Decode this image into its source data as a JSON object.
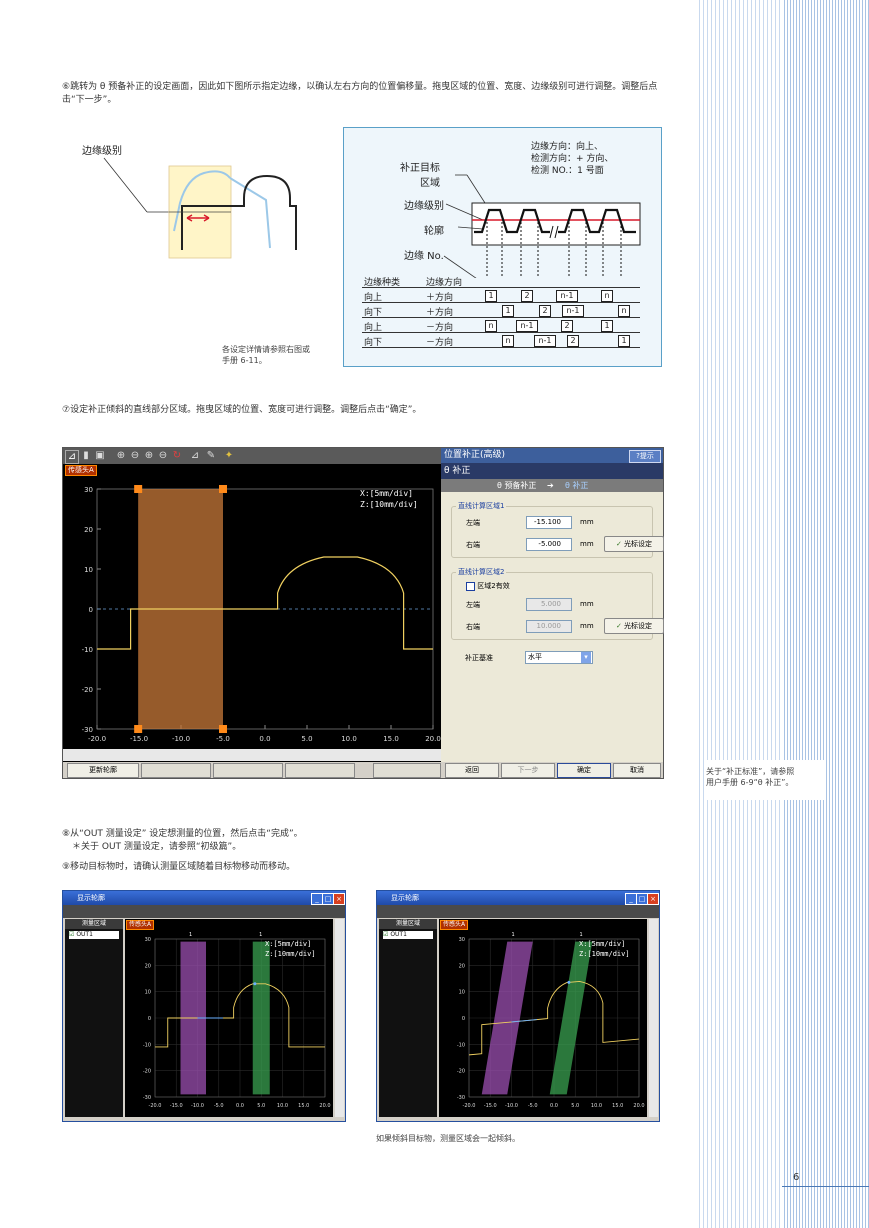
{
  "step6": {
    "text": "⑥跳转为 θ 预备补正的设定画面，因此如下图所示指定边缘，以确认左右方向的位置偏移量。拖曳区域的位置、宽度、边缘级别可进行调整。调整后点击“下一步”。"
  },
  "step7": {
    "text": "⑦设定补正倾斜的直线部分区域。拖曳区域的位置、宽度可进行调整。调整后点击“确定”。"
  },
  "step8": {
    "line1": "⑧从“OUT 测量设定” 设定想测量的位置，然后点击“完成”。",
    "line2": "＊关于 OUT 测量设定，请参照“初级篇”。"
  },
  "step9": {
    "text": "⑨移动目标物时，请确认测量区域随着目标物移动而移动。"
  },
  "left_diagram": {
    "edge_level_label": "边缘级别"
  },
  "left_note": {
    "line1": "各设定详情请参照右图或",
    "line2": "手册 6-11。"
  },
  "right_diagram": {
    "target_area_line1": "补正目标",
    "target_area_line2": "区域",
    "edge_level": "边缘级别",
    "profile": "轮廓",
    "edge_no": "边缘 No.",
    "info_line1": "边缘方向：向上、",
    "info_line2": "检测方向：+ 方向、",
    "info_line3": "检测 NO.：1 号面",
    "table_header_type": "边缘种类",
    "table_header_dir": "边缘方向",
    "rows": [
      {
        "type": "向上",
        "dir": "＋方向",
        "boxes": [
          "1",
          "2",
          "n-1",
          "n"
        ]
      },
      {
        "type": "向下",
        "dir": "＋方向",
        "boxes": [
          "1",
          "2",
          "n-1",
          "n"
        ]
      },
      {
        "type": "向上",
        "dir": "－方向",
        "boxes": [
          "n",
          "n-1",
          "2",
          "1"
        ]
      },
      {
        "type": "向下",
        "dir": "－方向",
        "boxes": [
          "n",
          "n-1",
          "2",
          "1"
        ]
      }
    ]
  },
  "app": {
    "sensor_tag": "传感头A",
    "scale_x": "X:[5mm/div]",
    "scale_z": "Z:[10mm/div]",
    "y_ticks": [
      "30",
      "20",
      "10",
      "0",
      "-10",
      "-20",
      "-30"
    ],
    "x_ticks": [
      "-20.0",
      "-15.0",
      "-10.0",
      "-5.0",
      "0.0",
      "5.0",
      "10.0",
      "15.0",
      "20.0"
    ],
    "panel_title": "位置补正(高级)",
    "help_btn": "提示",
    "panel_subtitle": "θ 补正",
    "step_prev": "θ 预备补正",
    "step_arrow": "➔",
    "step_current": "θ 补正",
    "group1_title": "直线计算区域1",
    "group1_left_label": "左端",
    "group1_left_value": "-15.100",
    "group1_right_label": "右端",
    "group1_right_value": "-5.000",
    "unit": "mm",
    "cursor_btn": "光标设定",
    "group2_title": "直线计算区域2",
    "group2_enable": "区域2有效",
    "group2_left_label": "左端",
    "group2_left_value": "5.000",
    "group2_right_label": "右端",
    "group2_right_value": "10.000",
    "ref_label": "补正基准",
    "ref_value": "水平",
    "bottom_left_btn": "更新轮廓",
    "btn_back": "返回",
    "btn_next": "下一步",
    "btn_ok": "确定",
    "btn_cancel": "取消"
  },
  "side_note": {
    "line1": "关于“补正标准”，请参照",
    "line2": "用户手册 6-9“θ 补正”。"
  },
  "win": {
    "title": "显示轮廓",
    "list_header": "测量区域",
    "out_item": "OUT1",
    "sensor_tag": "传感头A",
    "scale_x": "X:[5mm/div]",
    "scale_z": "Z:[10mm/div]",
    "y_ticks": [
      "30",
      "20",
      "10",
      "0",
      "-10",
      "-20",
      "-30"
    ],
    "x_ticks": [
      "-20.0",
      "-15.0",
      "-10.0",
      "-5.0",
      "0.0",
      "5.0",
      "10.0",
      "15.0",
      "20.0"
    ],
    "region1_tag": "1",
    "region2_tag": "1"
  },
  "bottom_caption": "如果倾斜目标物，测量区域会一起倾斜。",
  "page_number": "6"
}
